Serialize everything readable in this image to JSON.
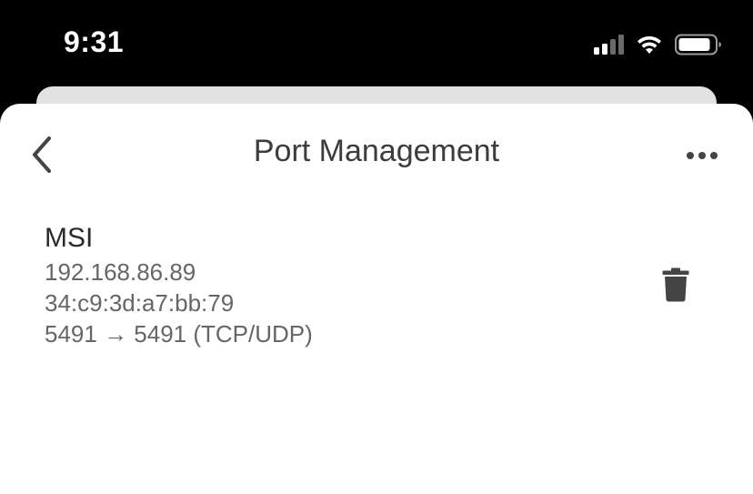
{
  "status_bar": {
    "time": "9:31",
    "signal_icon": "cellular-signal-icon",
    "wifi_icon": "wifi-icon",
    "battery_icon": "battery-icon",
    "text_color": "#ffffff"
  },
  "nav": {
    "title": "Port Management",
    "back_icon": "chevron-left-icon",
    "more_icon": "more-horizontal-icon"
  },
  "entries": [
    {
      "name": "MSI",
      "ip": "192.168.86.89",
      "mac": "34:c9:3d:a7:bb:79",
      "ports": "5491 → 5491 (TCP/UDP)",
      "delete_icon": "trash-icon"
    }
  ],
  "colors": {
    "background": "#000000",
    "sheet": "#ffffff",
    "sheet_behind": "#e2e2e2",
    "title_text": "#3c3c3c",
    "secondary_text": "#666666",
    "icon": "#444444"
  }
}
